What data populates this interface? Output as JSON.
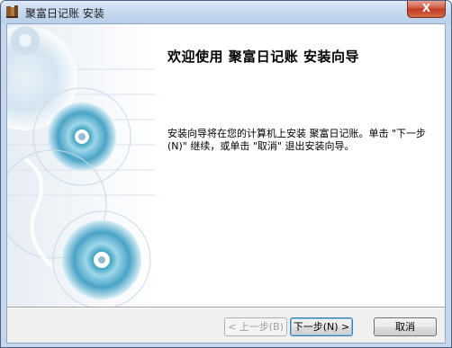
{
  "window": {
    "title": "聚富日记账 安装",
    "close_label": "X"
  },
  "wizard": {
    "heading": "欢迎使用 聚富日记账 安装向导",
    "body": "安装向导将在您的计算机上安装 聚富日记账。单击 \"下一步(N)\" 继续，或单击 \"取消\" 退出安装向导。"
  },
  "buttons": {
    "back": "< 上一步(B)",
    "next": "下一步(N) >",
    "cancel": "取消"
  },
  "icons": {
    "app": "installer-app-icon",
    "banner": "disc-banner-illustration"
  },
  "colors": {
    "title_bar": "#c4d8ee",
    "close_button": "#c3391f",
    "banner_disc": "#4aa3c6",
    "dialog_bg": "#f0f0f0"
  }
}
